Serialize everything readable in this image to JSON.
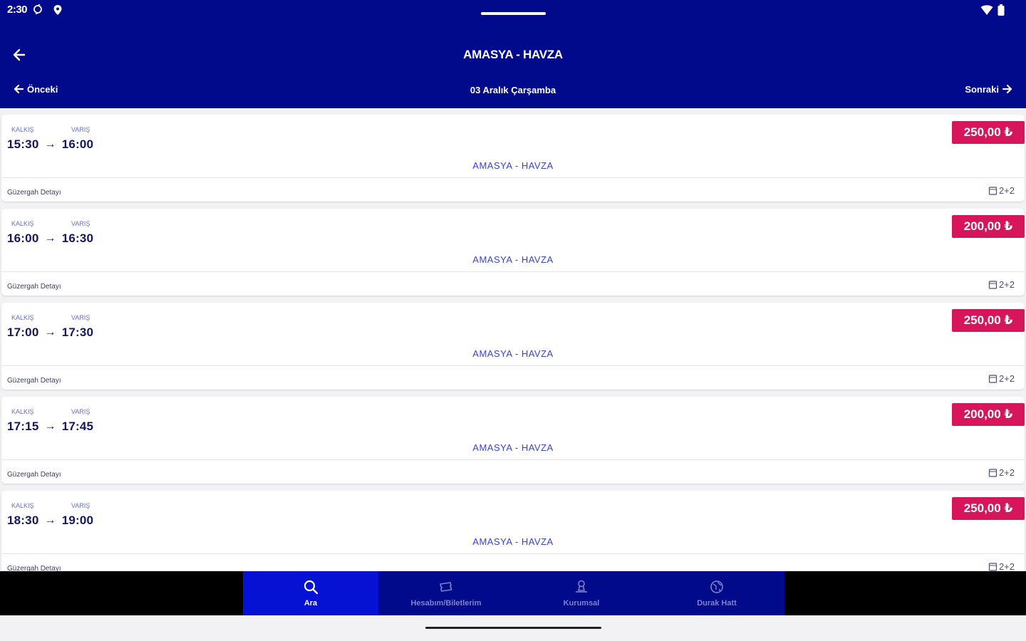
{
  "status_bar": {
    "time": "2:30",
    "icons": [
      "sync-icon",
      "location-icon",
      "wifi-icon",
      "battery-icon"
    ]
  },
  "header": {
    "title": "AMASYA - HAVZA",
    "prev_label": "Önceki",
    "date": "03 Aralık Çarşamba",
    "next_label": "Sonraki",
    "background": "#020a8c"
  },
  "trips": [
    {
      "departure_label": "KALKIŞ",
      "arrival_label": "VARIŞ",
      "departure": "15:30",
      "arrival": "16:00",
      "price": "250,00 ₺",
      "route": "AMASYA - HAVZA",
      "detail_label": "Güzergah Detayı",
      "seat_layout": "2+2"
    },
    {
      "departure_label": "KALKIŞ",
      "arrival_label": "VARIŞ",
      "departure": "16:00",
      "arrival": "16:30",
      "price": "200,00 ₺",
      "route": "AMASYA - HAVZA",
      "detail_label": "Güzergah Detayı",
      "seat_layout": "2+2"
    },
    {
      "departure_label": "KALKIŞ",
      "arrival_label": "VARIŞ",
      "departure": "17:00",
      "arrival": "17:30",
      "price": "250,00 ₺",
      "route": "AMASYA - HAVZA",
      "detail_label": "Güzergah Detayı",
      "seat_layout": "2+2"
    },
    {
      "departure_label": "KALKIŞ",
      "arrival_label": "VARIŞ",
      "departure": "17:15",
      "arrival": "17:45",
      "price": "200,00 ₺",
      "route": "AMASYA - HAVZA",
      "detail_label": "Güzergah Detayı",
      "seat_layout": "2+2"
    },
    {
      "departure_label": "KALKIŞ",
      "arrival_label": "VARIŞ",
      "departure": "18:30",
      "arrival": "19:00",
      "price": "250,00 ₺",
      "route": "AMASYA - HAVZA",
      "detail_label": "Güzergah Detayı",
      "seat_layout": "2+2"
    }
  ],
  "tabs": [
    {
      "label": "Ara",
      "icon": "search-icon",
      "active": true
    },
    {
      "label": "Hesabım/Biletlerim",
      "icon": "ticket-icon",
      "active": false
    },
    {
      "label": "Kurumsal",
      "icon": "company-icon",
      "active": false
    },
    {
      "label": "Durak Hatt",
      "icon": "globe-icon",
      "active": false
    }
  ],
  "colors": {
    "primary": "#020a8c",
    "tab_active": "#0512d4",
    "price_badge": "#d6155a",
    "route_text": "#3a44c4"
  }
}
